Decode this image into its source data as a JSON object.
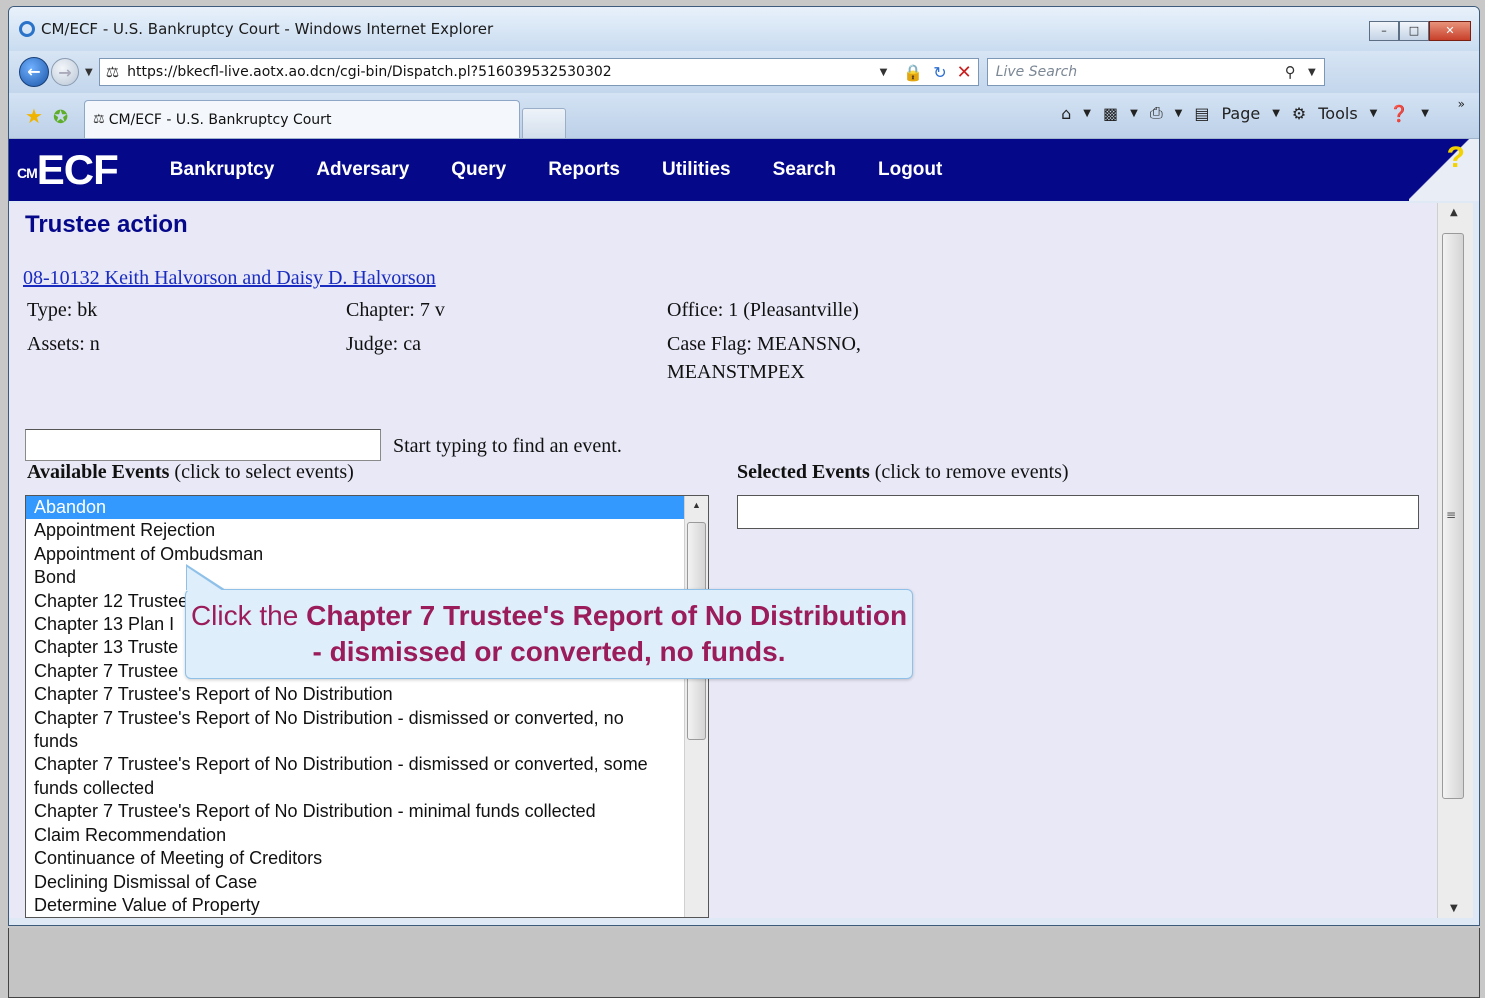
{
  "window": {
    "title": "CM/ECF - U.S. Bankruptcy Court - Windows Internet Explorer",
    "min": "–",
    "max": "□",
    "close": "✕"
  },
  "address": {
    "url": "https://bkecfl-live.aotx.ao.dcn/cgi-bin/Dispatch.pl?516039532530302",
    "search_placeholder": "Live Search"
  },
  "tabs": {
    "active_label": "CM/ECF - U.S. Bankruptcy Court"
  },
  "commandbar": {
    "page_label": "Page",
    "tools_label": "Tools"
  },
  "banner": {
    "logo_prefix": "CM",
    "logo": "ECF",
    "menu": [
      "Bankruptcy",
      "Adversary",
      "Query",
      "Reports",
      "Utilities",
      "Search",
      "Logout"
    ],
    "help": "?"
  },
  "page": {
    "title": "Trustee action",
    "case_link": "08-10132 Keith Halvorson and Daisy D. Halvorson",
    "type": "Type: bk",
    "chapter": "Chapter: 7 v",
    "office": "Office: 1 (Pleasantville)",
    "assets": "Assets: n",
    "judge": "Judge: ca",
    "case_flag_line1": "Case Flag: MEANSNO,",
    "case_flag_line2": "MEANSTMPEX",
    "search_hint": "Start typing to find an event.",
    "available_heading": "Available Events",
    "available_sub": " (click to select events)",
    "selected_heading": "Selected Events",
    "selected_sub": " (click to remove events)"
  },
  "events": [
    "Abandon",
    "Appointment Rejection",
    "Appointment of Ombudsman",
    "Bond",
    "Chapter 12 Trustee",
    "Chapter 13 Plan I",
    "Chapter 13 Truste",
    "Chapter 7 Trustee",
    "Chapter 7 Trustee's Report of No Distribution",
    "Chapter 7 Trustee's Report of No Distribution - dismissed or converted, no",
    "funds",
    "Chapter 7 Trustee's Report of No Distribution - dismissed or converted, some",
    "funds collected",
    "Chapter 7 Trustee's Report of No Distribution - minimal funds collected",
    "Claim Recommendation",
    "Continuance of Meeting of Creditors",
    "Declining Dismissal of Case",
    "Determine Value of Property"
  ],
  "callout": {
    "prefix": "Click the ",
    "bold": "Chapter 7 Trustee's Report of No Distribution - dismissed or converted, no funds."
  }
}
